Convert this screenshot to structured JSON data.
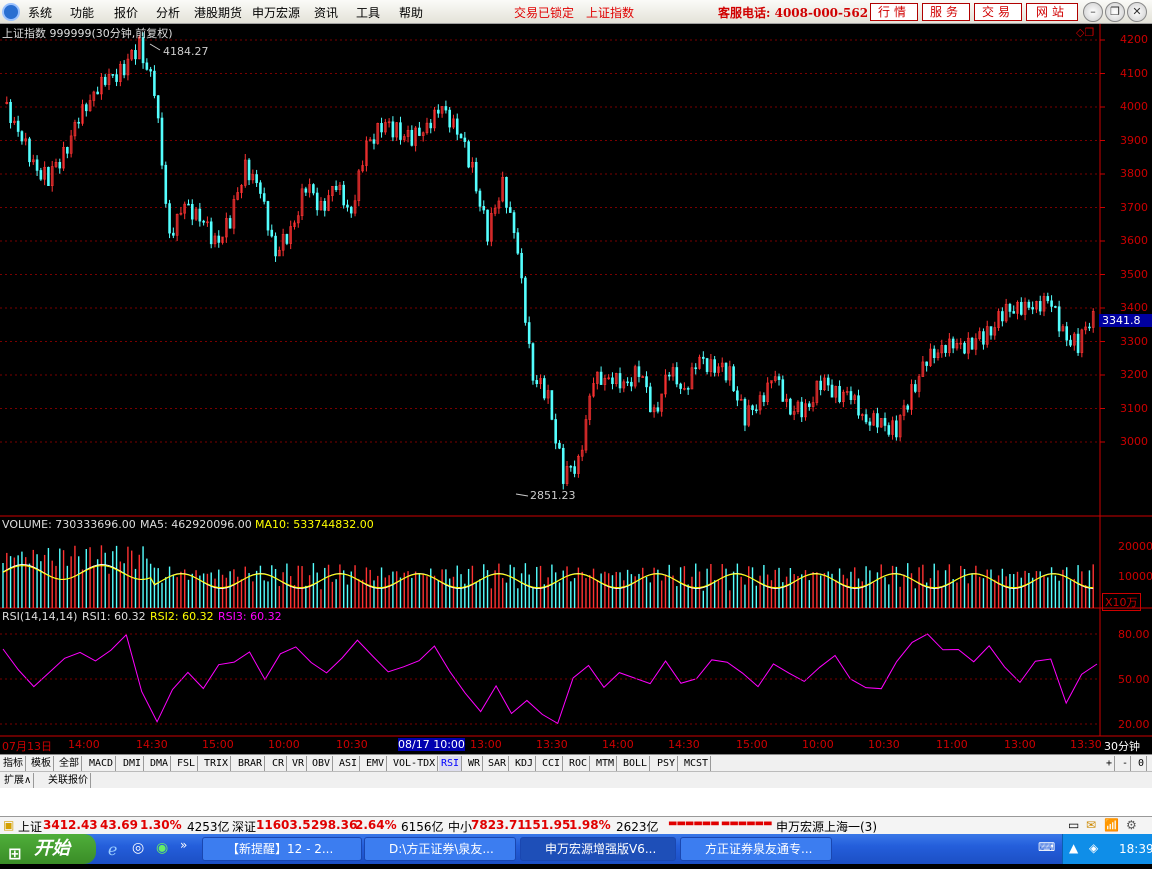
{
  "menubar": {
    "items": [
      "系统",
      "功能",
      "报价",
      "分析",
      "港股期货",
      "申万宏源",
      "资讯",
      "工具",
      "帮助"
    ],
    "status_locked": "交易已锁定",
    "status_index": "上证指数",
    "hotline": "客服电话: 4008-000-562",
    "buttons": [
      "行情",
      "服务",
      "交易",
      "网站"
    ]
  },
  "main_chart": {
    "header": "上证指数 999999(30分钟,前复权)",
    "high_label": "4184.27",
    "low_label": "2851.23",
    "current_price": "3341.8",
    "y_ticks": [
      "4200",
      "4100",
      "4000",
      "3900",
      "3800",
      "3700",
      "3600",
      "3500",
      "3400",
      "3300",
      "3200",
      "3100",
      "3000"
    ]
  },
  "volume": {
    "label": "VOLUME: 730333696.00",
    "ma5": "MA5: 462920096.00",
    "ma10": "MA10: 533744832.00",
    "y_ticks": [
      "20000",
      "10000"
    ],
    "unit": "X10万"
  },
  "rsi": {
    "label": "RSI(14,14,14)",
    "rsi1": "RSI1: 60.32",
    "rsi2": "RSI2: 60.32",
    "rsi3": "RSI3: 60.32",
    "y_ticks": [
      "80.00",
      "50.00",
      "20.00"
    ]
  },
  "time_axis": {
    "labels": [
      "07月13日",
      "14:00",
      "14:30",
      "15:00",
      "10:00",
      "10:30",
      "08/17 10:00",
      "13:00",
      "13:30",
      "14:00",
      "14:30",
      "15:00",
      "10:00",
      "10:30",
      "11:00",
      "13:00",
      "13:30"
    ],
    "period": "30分钟"
  },
  "tabs": [
    "指标",
    "模板",
    "全部",
    "MACD",
    "DMI",
    "DMA",
    "FSL",
    "TRIX",
    "BRAR",
    "CR",
    "VR",
    "OBV",
    "ASI",
    "EMV",
    "VOL-TDX",
    "RSI",
    "WR",
    "SAR",
    "KDJ",
    "CCI",
    "ROC",
    "MTM",
    "BOLL",
    "PSY",
    "MCST"
  ],
  "selected_tab": "RSI",
  "ext_tabs": [
    "扩展∧",
    "关联报价"
  ],
  "ticker": {
    "sh_name": "上证",
    "sh_value": "3412.43",
    "sh_change": "43.69",
    "sh_pct": "1.30%",
    "sh_amount": "4253亿",
    "sz_name": "深证",
    "sz_value": "11603.5",
    "sz_change": "298.36",
    "sz_pct": "2.64%",
    "sz_amount": "6156亿",
    "zx_name": "中小",
    "zx_value": "7823.71",
    "zx_change": "151.95",
    "zx_pct": "1.98%",
    "zx_amount": "2623亿",
    "server": "申万宏源上海一(3)"
  },
  "taskbar": {
    "start": "开始",
    "tasks": [
      "【新提醒】12 - 2...",
      "D:\\方正证券\\泉友...",
      "申万宏源增强版V6...",
      "方正证券泉友通专..."
    ],
    "clock": "18:39"
  },
  "chart_data": [
    {
      "type": "candlestick",
      "title": "上证指数 999999(30分钟,前复权)",
      "y_range": [
        2851.23,
        4184.27
      ],
      "annotations": [
        {
          "label": "4184.27",
          "kind": "high"
        },
        {
          "label": "2851.23",
          "kind": "low"
        }
      ],
      "last_price": 3341.8,
      "series_close": [
        4010,
        3940,
        3820,
        3790,
        3860,
        3960,
        4050,
        4080,
        4120,
        4184,
        4050,
        3620,
        3700,
        3680,
        3590,
        3660,
        3830,
        3740,
        3570,
        3620,
        3770,
        3700,
        3760,
        3690,
        3880,
        3950,
        3930,
        3900,
        3950,
        3990,
        3940,
        3810,
        3620,
        3780,
        3560,
        3200,
        3130,
        2900,
        2940,
        3180,
        3200,
        3160,
        3220,
        3080,
        3210,
        3160,
        3240,
        3230,
        3200,
        3070,
        3130,
        3190,
        3100,
        3090,
        3180,
        3150,
        3130,
        3070,
        3050,
        3040,
        3150,
        3240,
        3290,
        3280,
        3300,
        3320,
        3380,
        3410,
        3390,
        3440,
        3320,
        3290,
        3390
      ],
      "high_low": "high 4184.27 / low 2851.23"
    },
    {
      "type": "bar",
      "title": "VOLUME",
      "ylim": [
        0,
        25000
      ],
      "ylabel": "X10万",
      "series": [
        {
          "name": "VOLUME",
          "values": [
            730333696
          ]
        },
        {
          "name": "MA5",
          "values": [
            462920096
          ]
        },
        {
          "name": "MA10",
          "values": [
            533744832
          ]
        }
      ]
    },
    {
      "type": "line",
      "title": "RSI(14,14,14)",
      "ylim": [
        20,
        80
      ],
      "series": [
        {
          "name": "RSI1",
          "values": [
            70,
            58,
            46,
            53,
            62,
            68,
            64,
            70,
            78,
            40,
            22,
            45,
            55,
            42,
            58,
            62,
            70,
            50,
            65,
            70,
            62,
            56,
            64,
            74,
            64,
            56,
            60,
            62,
            70,
            54,
            42,
            30,
            45,
            25,
            35,
            28,
            22,
            50,
            57,
            44,
            56,
            52,
            46,
            60,
            47,
            52,
            64,
            60,
            52,
            45,
            62,
            55,
            47,
            56,
            66,
            52,
            45,
            42,
            60,
            75,
            82,
            70,
            68,
            60,
            73,
            60,
            48,
            60,
            62,
            35,
            55,
            60
          ]
        }
      ],
      "last_values": {
        "RSI1": 60.32,
        "RSI2": 60.32,
        "RSI3": 60.32
      }
    }
  ]
}
